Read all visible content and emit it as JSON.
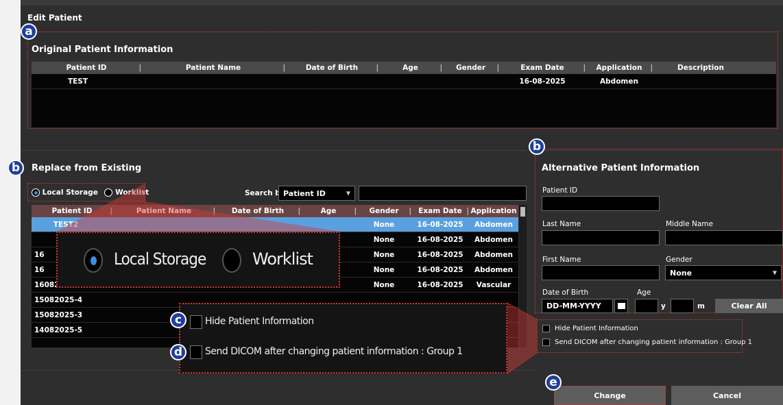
{
  "dialog": {
    "title": "Edit Patient"
  },
  "original": {
    "title": "Original Patient Information",
    "columns": [
      "Patient ID",
      "Patient Name",
      "Date of Birth",
      "Age",
      "Gender",
      "Exam Date",
      "Application",
      "Description"
    ],
    "rows": [
      {
        "id": "TEST",
        "name": "",
        "dob": "",
        "age": "",
        "gender": "",
        "exam": "16-08-2025",
        "app": "Abdomen",
        "desc": ""
      }
    ]
  },
  "replace": {
    "title": "Replace from Existing",
    "local_label": "Local Storage",
    "worklist_label": "Worklist",
    "search_by_label": "Search by",
    "search_by_value": "Patient ID",
    "columns": [
      "Patient ID",
      "Patient Name",
      "Date of Birth",
      "Age",
      "Gender",
      "Exam Date",
      "Application"
    ],
    "rows": [
      {
        "id": "TEST2",
        "gender": "None",
        "exam": "16-08-2025",
        "app": "Abdomen"
      },
      {
        "id": "",
        "gender": "None",
        "exam": "16-08-2025",
        "app": "Abdomen"
      },
      {
        "id": "16",
        "gender": "None",
        "exam": "16-08-2025",
        "app": "Abdomen"
      },
      {
        "id": "16",
        "gender": "None",
        "exam": "16-08-2025",
        "app": "Abdomen"
      },
      {
        "id": "16082025-1",
        "gender": "None",
        "exam": "16-08-2025",
        "app": "Vascular"
      },
      {
        "id": "15082025-4",
        "gender": "",
        "exam": "",
        "app": ""
      },
      {
        "id": "15082025-3",
        "gender": "",
        "exam": "",
        "app": ""
      },
      {
        "id": "14082025-5",
        "gender": "",
        "exam": "",
        "app": ""
      }
    ]
  },
  "alt": {
    "title": "Alternative Patient Information",
    "patient_id_label": "Patient ID",
    "last_name_label": "Last Name",
    "middle_name_label": "Middle Name",
    "first_name_label": "First Name",
    "gender_label": "Gender",
    "gender_value": "None",
    "dob_label": "Date of Birth",
    "dob_value": "DD-MM-YYYY",
    "age_label": "Age",
    "age_y": "y",
    "age_m": "m",
    "clear_all": "Clear All",
    "hide_info": "Hide Patient Information",
    "send_dicom": "Send DICOM after changing patient information : Group 1"
  },
  "zoom": {
    "local_label": "Local Storage",
    "worklist_label": "Worklist",
    "hide_info": "Hide Patient Information",
    "send_dicom": "Send DICOM after changing patient information : Group 1"
  },
  "buttons": {
    "change": "Change",
    "cancel": "Cancel"
  },
  "badges": {
    "a": "a",
    "b": "b",
    "c": "c",
    "d": "d",
    "e": "e"
  },
  "colors": {
    "accent": "#5aa0df",
    "annotation": "#d9342f",
    "badge": "#1f3f9a"
  }
}
